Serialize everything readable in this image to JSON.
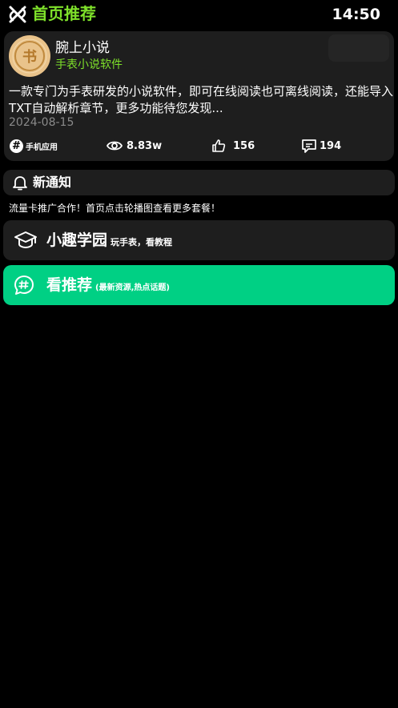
{
  "header": {
    "title": "首页推荐",
    "time": "14:50",
    "logo_icon": "crossed-x-logo-icon",
    "title_color": "#7ee02a"
  },
  "app_card": {
    "icon": "book-coin-icon",
    "icon_glyph": "书",
    "name": "腕上小说",
    "tag": "手表小说软件",
    "description": "一款专门为手表研发的小说软件，即可在线阅读也可离线阅读，还能导入TXT自动解析章节，更多功能待您发现...",
    "date": "2024-08-15",
    "category": "手机应用",
    "category_glyph": "#",
    "views": "8.83w",
    "likes": "156",
    "comments": "194"
  },
  "notice": {
    "title": "新通知",
    "icon": "bell-icon",
    "text": "流量卡推广合作！首页点击轮播图查看更多套餐！"
  },
  "menu": {
    "school": {
      "title": "小趣学园",
      "subtitle": "玩手表，看教程",
      "icon": "graduation-cap-icon"
    },
    "recommend": {
      "title": "看推荐",
      "subtitle": "(最新资源,热点话题)",
      "icon": "hash-chat-icon",
      "color": "#00d084"
    }
  }
}
